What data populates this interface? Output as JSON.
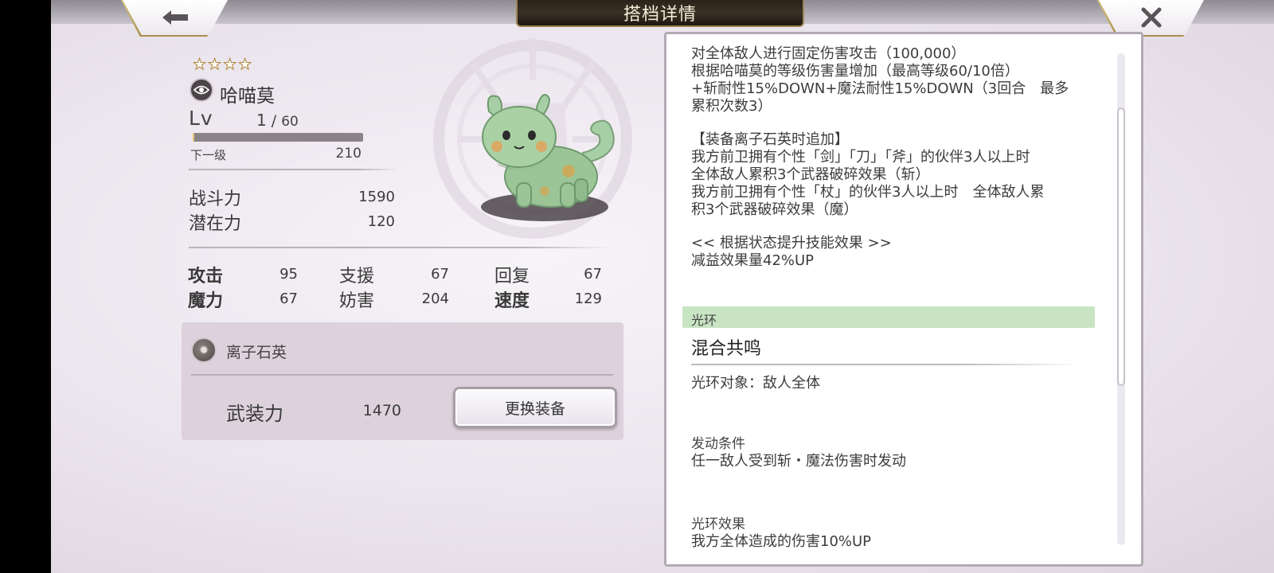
{
  "header": {
    "title": "搭档详情",
    "back_icon": "back-arrow-icon",
    "close_icon": "close-icon"
  },
  "character": {
    "stars": 4,
    "name": "哈喵莫",
    "level_label": "Lv",
    "level_current": "1",
    "level_max": "60",
    "level_progress": 1,
    "next_level_label": "下一级",
    "next_level_exp": "210",
    "combat_label": "战斗力",
    "combat_value": "1590",
    "potential_label": "潜在力",
    "potential_value": "120"
  },
  "stats": [
    {
      "label": "攻击",
      "value": "95",
      "bold": true
    },
    {
      "label": "支援",
      "value": "67",
      "bold": false
    },
    {
      "label": "回复",
      "value": "67",
      "bold": false
    },
    {
      "label": "魔力",
      "value": "67",
      "bold": true
    },
    {
      "label": "妨害",
      "value": "204",
      "bold": false
    },
    {
      "label": "速度",
      "value": "129",
      "bold": true
    }
  ],
  "equipment": {
    "name": "离子石英",
    "armor_label": "武装力",
    "armor_value": "1470",
    "change_button": "更换装备"
  },
  "skill_text": {
    "line0": "对全体敌人进行固定伤害攻击（100,000）",
    "line1": "根据哈喵莫的等级伤害量增加（最高等级60/10倍）",
    "line2": "+斩耐性15%DOWN+魔法耐性15%DOWN（3回合　最多",
    "line3": "累积次数3）",
    "line4": "【装备离子石英时追加】",
    "line5": "我方前卫拥有个性「剑」「刀」「斧」的伙伴3人以上时",
    "line6": "全体敌人累积3个武器破碎效果（斩）",
    "line7": "我方前卫拥有个性「杖」的伙伴3人以上时　全体敌人累",
    "line8": "积3个武器破碎效果（魔）",
    "line9": "<< 根据状态提升技能效果 >>",
    "line10": "减益效果量42%UP"
  },
  "aura": {
    "section_label": "光环",
    "name": "混合共鸣",
    "target": "光环对象：敌人全体",
    "condition_label": "发动条件",
    "condition": "任一敌人受到斩・魔法伤害时发动",
    "effect_label": "光环效果",
    "effect": "我方全体造成的伤害10%UP"
  },
  "colors": {
    "aura_bar": "#c8e4c3",
    "title_plate": "#2a221a",
    "star_outline": "#b08a3c"
  }
}
